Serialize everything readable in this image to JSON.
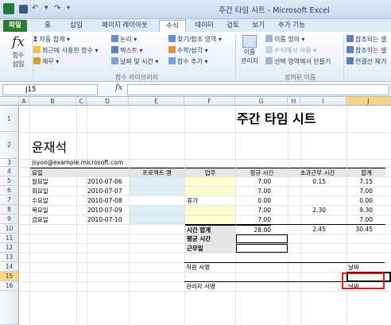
{
  "window": {
    "title": "주간 타임 시트 - Microsoft Excel"
  },
  "quick_access": {
    "icons": [
      "excel-logo-icon",
      "save-icon",
      "undo-icon",
      "redo-icon",
      "customize-icon"
    ]
  },
  "tabs": [
    {
      "label": "파일",
      "kind": "file"
    },
    {
      "label": "홈"
    },
    {
      "label": "삽입"
    },
    {
      "label": "페이지 레이아웃"
    },
    {
      "label": "수식",
      "active": true
    },
    {
      "label": "데이터"
    },
    {
      "label": "검토"
    },
    {
      "label": "보기"
    },
    {
      "label": "추가 기능"
    }
  ],
  "ribbon": {
    "insert_function": {
      "glyph": "fx",
      "label1": "함수",
      "label2": "삽입"
    },
    "library": {
      "autosum": "자동 합계 ▾",
      "recent": "최근에 사용한 함수 ▾",
      "financial": "재무 ▾",
      "logical": "논리 ▾",
      "text": "텍스트 ▾",
      "datetime": "날짜 및 시간 ▾",
      "lookup": "찾기/참조 영역 ▾",
      "math": "수학/삼각 ▾",
      "more": "함수 추가 ▾",
      "group": "함수 라이브러리"
    },
    "names": {
      "manager_label1": "이름",
      "manager_label2": "관리자",
      "define": "이름 정의 ▾",
      "use_in_formula": "수식에서 사용 ▾",
      "create_from_selection": "선택 영역에서 만들기",
      "group": "정의된 이름"
    },
    "audit": {
      "trace_precedents": "참조되는 셀",
      "trace_dependents": "참조하는 셀",
      "remove_arrows": "연결선 제거"
    }
  },
  "formula_bar": {
    "name_box": "J15",
    "formula": ""
  },
  "columns": [
    "A",
    "B",
    "C",
    "D",
    "E",
    "F",
    "G",
    "H",
    "I",
    "J"
  ],
  "rows": [
    "1",
    "2",
    "3",
    "4",
    "5",
    "6",
    "7",
    "8",
    "9",
    "10",
    "11",
    "12",
    "13",
    "14",
    "15",
    "16"
  ],
  "sheet": {
    "title": "주간 타임 시트",
    "name": "윤재석",
    "email": "jsyoo@example.microsoft.com",
    "headers": {
      "day": "요일",
      "project": "프로젝트 명",
      "task": "업무",
      "regular": "정규 시간",
      "overtime": "초과근무 시간",
      "total": "합계"
    },
    "entries": [
      {
        "day": "월요일",
        "date": "2010-07-06",
        "project": "",
        "task": "",
        "regular": "7.00",
        "overtime": "0.15",
        "total": "7.15"
      },
      {
        "day": "화요일",
        "date": "2010-07-07",
        "project": "",
        "task": "",
        "regular": "7.00",
        "overtime": "",
        "total": "7.00"
      },
      {
        "day": "수요일",
        "date": "2010-07-08",
        "project": "휴가",
        "task": "",
        "regular": "0.00",
        "overtime": "",
        "total": "0.00"
      },
      {
        "day": "목요일",
        "date": "2010-07-09",
        "project": "",
        "task": "",
        "regular": "7.00",
        "overtime": "2.30",
        "total": "9.30"
      },
      {
        "day": "금요일",
        "date": "2010-07-10",
        "project": "",
        "task": "",
        "regular": "7.00",
        "overtime": "",
        "total": "7.00"
      }
    ],
    "totals": {
      "label": "시간 합계",
      "regular": "28.00",
      "overtime": "2.45",
      "total": "30.45"
    },
    "avg_label": "평균 시간",
    "wage_label": "근무일",
    "employee_sign": "직원 서명",
    "manager_sign": "관리자 서명",
    "date_label": "날짜"
  },
  "colors": {
    "file_tab": "#2a7a34",
    "input_blue": "#daeef3",
    "input_yellow": "#ffffcc",
    "header_grey": "#e6e6e6",
    "selection": "#e8141b"
  }
}
